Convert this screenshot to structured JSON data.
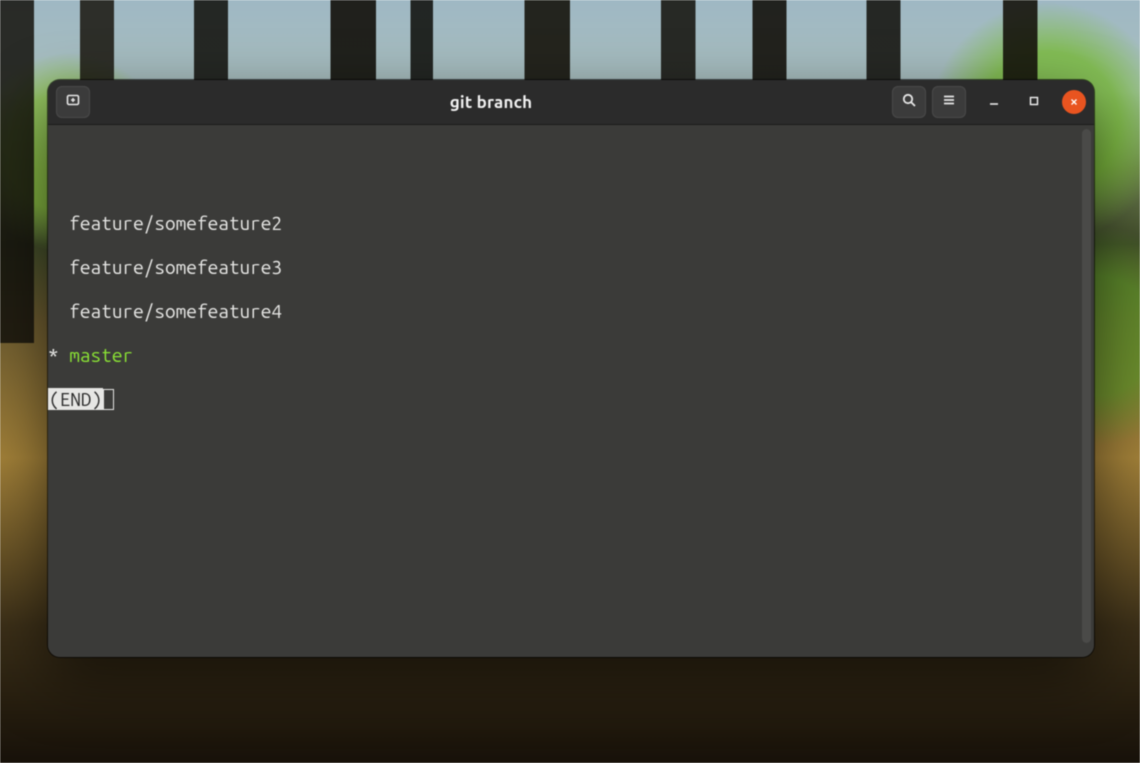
{
  "window": {
    "title": "git branch"
  },
  "terminal": {
    "branches": [
      {
        "name": "feature/somefeature2",
        "current": false
      },
      {
        "name": "feature/somefeature3",
        "current": false
      },
      {
        "name": "feature/somefeature4",
        "current": false
      },
      {
        "name": "master",
        "current": true
      }
    ],
    "current_marker": "*",
    "pager_end": "(END)"
  },
  "colors": {
    "current_branch": "#8ae234",
    "close_button": "#e95420",
    "terminal_bg": "#3b3b39",
    "titlebar_bg": "#2b2b2b"
  },
  "icons": {
    "new_tab": "new-tab-icon",
    "search": "search-icon",
    "menu": "hamburger-icon",
    "minimize": "minimize-icon",
    "maximize": "maximize-icon",
    "close": "close-icon"
  }
}
